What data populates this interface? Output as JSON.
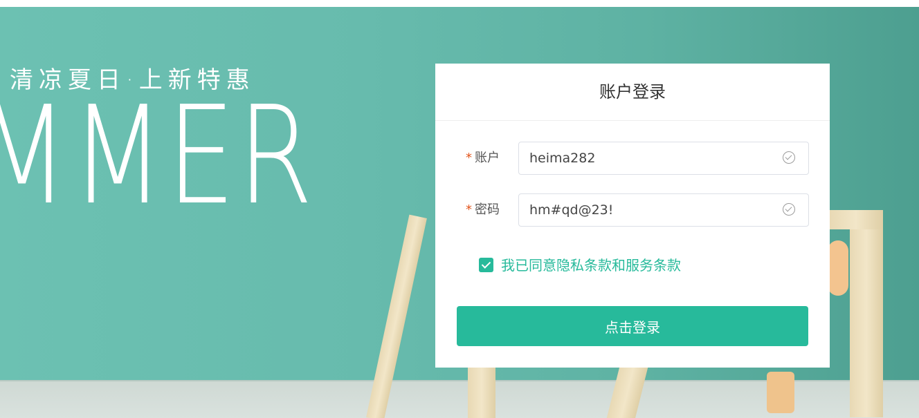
{
  "banner": {
    "slogan": "清凉夏日·上新特惠",
    "big_word": "MMER"
  },
  "login": {
    "title": "账户登录",
    "required_mark": "*",
    "account": {
      "label": "账户",
      "value": "heima282"
    },
    "password": {
      "label": "密码",
      "value": "hm#qd@23!"
    },
    "agree_text": "我已同意隐私条款和服务条款",
    "submit_label": "点击登录"
  },
  "colors": {
    "accent": "#27ba9b",
    "required": "#e2541b",
    "banner": "#67bbad"
  },
  "icons": [
    "check-circle-icon",
    "checkbox-checked-icon"
  ]
}
